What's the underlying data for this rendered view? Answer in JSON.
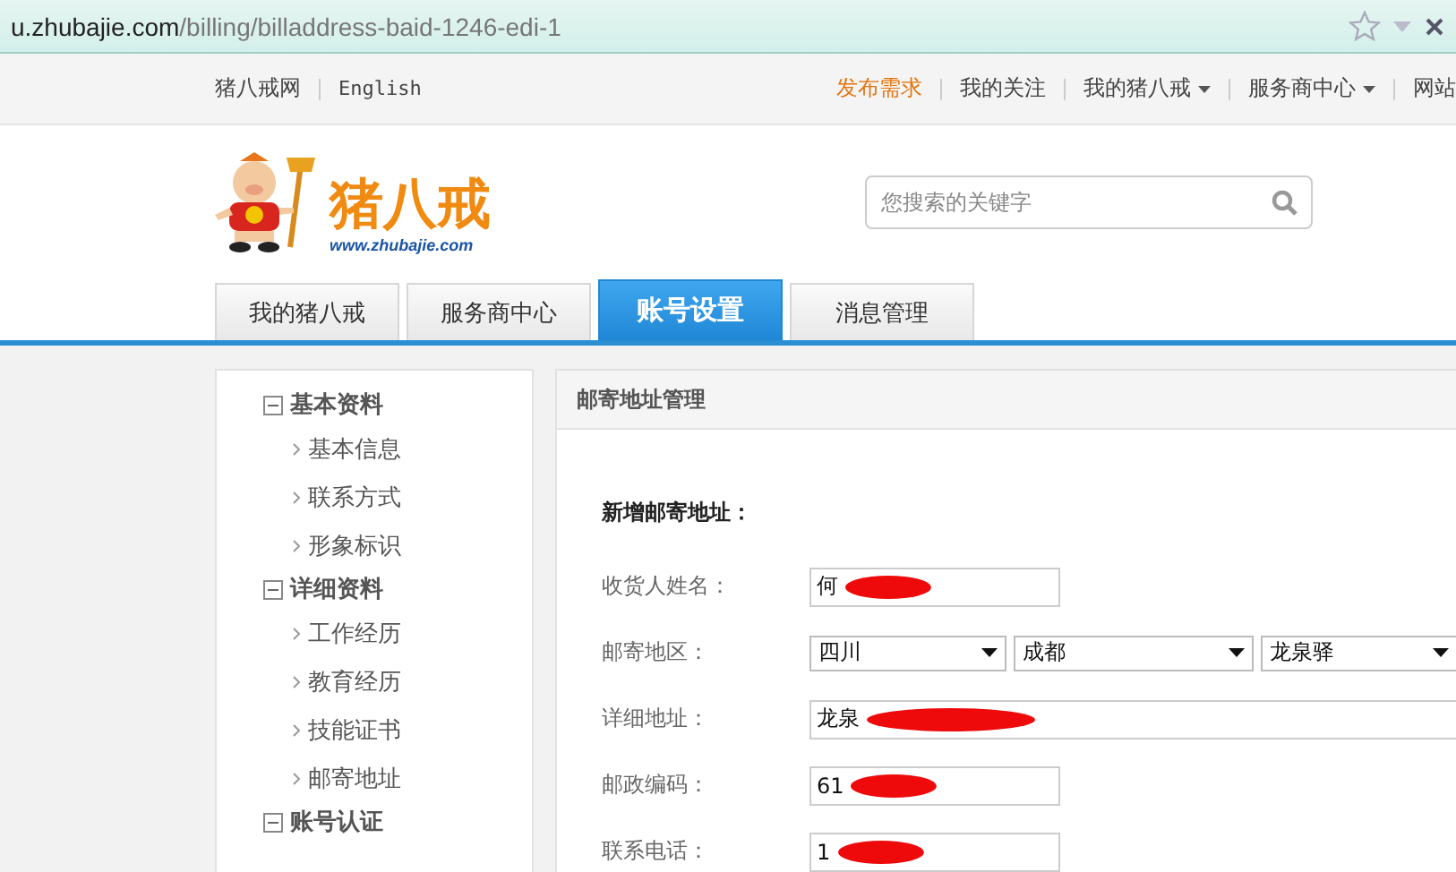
{
  "address_bar": {
    "url_host": "u.zhubajie.com",
    "url_path": "/billing/billaddress-baid-1246-edi-1"
  },
  "top_nav": {
    "left": [
      "猪八戒网",
      "English"
    ],
    "right": [
      {
        "label": "发布需求",
        "highlighted": true,
        "dropdown": false
      },
      {
        "label": "我的关注",
        "highlighted": false,
        "dropdown": false
      },
      {
        "label": "我的猪八戒",
        "highlighted": false,
        "dropdown": true
      },
      {
        "label": "服务商中心",
        "highlighted": false,
        "dropdown": true
      },
      {
        "label": "网站",
        "highlighted": false,
        "dropdown": false
      }
    ]
  },
  "logo": {
    "name": "猪八戒",
    "url": "www.zhubajie.com"
  },
  "search": {
    "placeholder": "您搜索的关键字"
  },
  "tabs": [
    {
      "label": "我的猪八戒",
      "selected": false
    },
    {
      "label": "服务商中心",
      "selected": false
    },
    {
      "label": "账号设置",
      "selected": true
    },
    {
      "label": "消息管理",
      "selected": false
    }
  ],
  "sidebar": [
    {
      "label": "基本资料",
      "expanded": true,
      "children": [
        {
          "label": "基本信息"
        },
        {
          "label": "联系方式"
        },
        {
          "label": "形象标识"
        }
      ]
    },
    {
      "label": "详细资料",
      "expanded": true,
      "children": [
        {
          "label": "工作经历"
        },
        {
          "label": "教育经历"
        },
        {
          "label": "技能证书"
        },
        {
          "label": "邮寄地址"
        }
      ]
    },
    {
      "label": "账号认证",
      "expanded": true
    }
  ],
  "panel": {
    "title": "邮寄地址管理",
    "form_title": "新增邮寄地址：",
    "fields": [
      {
        "kind": "text",
        "label": "收货人姓名：",
        "value": "何",
        "redacted": true,
        "wide": false
      },
      {
        "kind": "select",
        "label": "邮寄地区：",
        "options": [
          "四川",
          "成都",
          "龙泉驿"
        ]
      },
      {
        "kind": "text",
        "label": "详细地址：",
        "value": "龙泉",
        "redacted": true,
        "wide": true
      },
      {
        "kind": "text",
        "label": "邮政编码：",
        "value": "61",
        "redacted": true,
        "wide": false
      },
      {
        "kind": "text",
        "label": "联系电话：",
        "value": "1",
        "redacted": true,
        "wide": false
      }
    ]
  }
}
